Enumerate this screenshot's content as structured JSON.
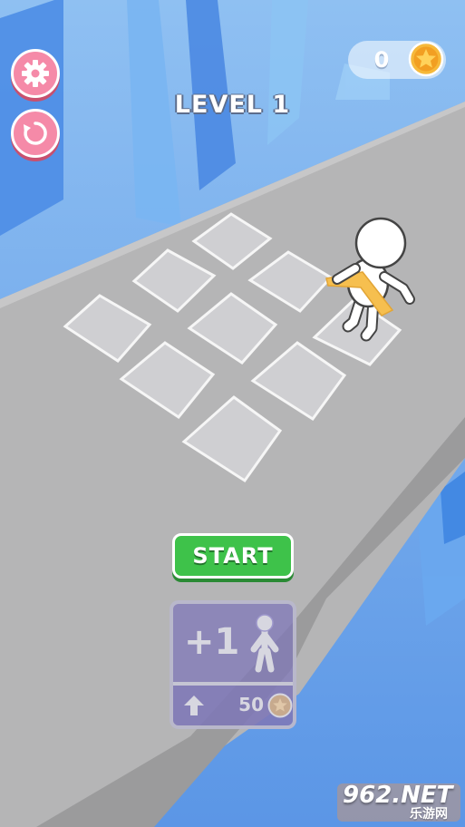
{
  "hud": {
    "level_label": "LEVEL 1",
    "coin_count": "0",
    "settings_icon": "gear-icon",
    "restart_icon": "restart-icon",
    "coin_icon": "star-coin-icon"
  },
  "board": {
    "tiles_total": 9,
    "occupied_tiles": 1
  },
  "controls": {
    "start_label": "START"
  },
  "upgrade": {
    "title": "+1",
    "cost": "50",
    "arrow_icon": "arrow-up-icon",
    "figure_icon": "stickman-icon",
    "coin_icon": "star-coin-icon"
  },
  "watermark": {
    "text": "962.NET",
    "subtext": "乐游网"
  },
  "colors": {
    "sky": "#5f9ae8",
    "road": "#b3b3b3",
    "start_green": "#3ec24a",
    "pink_button": "#f58aa8",
    "coin_gold": "#f6b93b"
  }
}
